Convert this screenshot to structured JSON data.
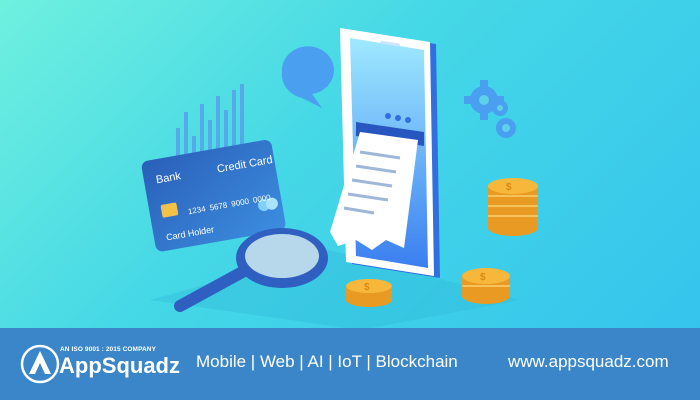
{
  "card": {
    "bank": "Bank",
    "type": "Credit Card",
    "number_1": "1234",
    "number_2": "5678",
    "number_3": "9000",
    "number_4": "0000",
    "holder": "Card Holder"
  },
  "footer": {
    "logo_tagline": "AN ISO 9001 : 2015 COMPANY",
    "logo_name": "AppSquadz",
    "services": "Mobile | Web | AI | IoT | Blockchain",
    "website": "www.appsquadz.com"
  },
  "colors": {
    "bg_top": "#6ff0df",
    "bg_bottom": "#33c2ee",
    "footer": "#3a86c8",
    "card": "#2f74c9",
    "phone": "#3f8af2",
    "coin": "#f5b034"
  },
  "icons": [
    "chat-bubble-icon",
    "gear-icon",
    "magnifier-icon",
    "coin-icon",
    "receipt-icon",
    "chip-icon",
    "bar-chart-icon"
  ]
}
